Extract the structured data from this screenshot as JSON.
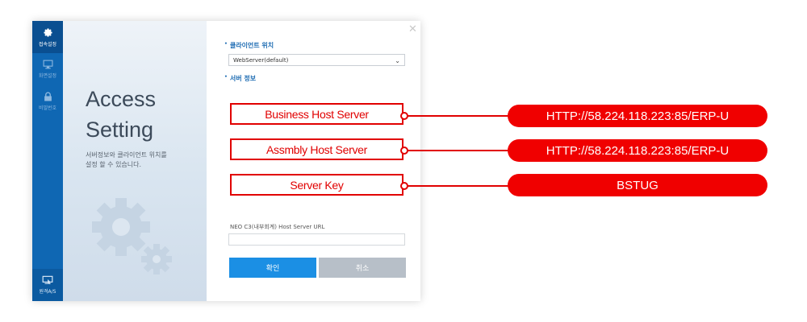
{
  "rail": {
    "items": [
      {
        "label": "접속설정",
        "icon": "gear-icon",
        "active": true
      },
      {
        "label": "화면설정",
        "icon": "monitor-icon",
        "active": false
      },
      {
        "label": "비밀번호",
        "icon": "lock-icon",
        "active": false
      }
    ],
    "bottom": {
      "label": "원격A/S",
      "icon": "remote-support-icon"
    }
  },
  "intro": {
    "title_line1": "Access",
    "title_line2": "Setting",
    "desc_line1": "서버정보와 클라이언트 위치를",
    "desc_line2": "설정 할 수 있습니다."
  },
  "form": {
    "client_location_label": "클라이언트 위치",
    "client_location_value": "WebServer(default)",
    "server_info_label": "서버 정보",
    "fields": [
      {
        "label": "Business Host Server",
        "value": "HTTP://58.224.118.223:85/ERP-U"
      },
      {
        "label": "Assmbly Host Server",
        "value": "HTTP://58.224.118.223:85/ERP-U"
      },
      {
        "label": "Server Key",
        "value": "BSTUG"
      }
    ],
    "url_label": "NEO C3(내부회계) Host Server URL",
    "url_value": "",
    "ok_label": "확인",
    "cancel_label": "취소"
  },
  "colors": {
    "accent_red": "#f00000",
    "rail_blue": "#0f67b3",
    "ok_blue": "#1b8fe4",
    "cancel_gray": "#b7bfc8"
  }
}
